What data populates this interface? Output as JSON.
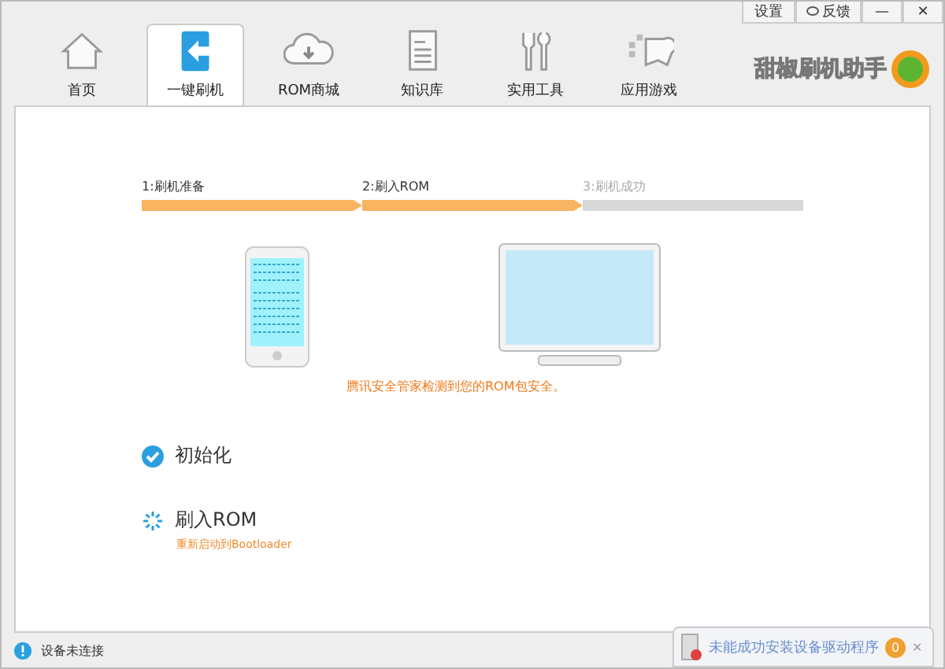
{
  "top_buttons": [
    {
      "kind": "text",
      "label": "设置"
    },
    {
      "kind": "feedback",
      "label": "反馈"
    },
    {
      "kind": "minimize",
      "label": "—"
    },
    {
      "kind": "close",
      "label": "✕"
    }
  ],
  "tabs": [
    {
      "label": "首页",
      "kind": "home",
      "selected": false
    },
    {
      "label": "一键刷机",
      "kind": "flash",
      "selected": true
    },
    {
      "label": "ROM商城",
      "kind": "cloud",
      "selected": false
    },
    {
      "label": "知识库",
      "kind": "doc",
      "selected": false
    },
    {
      "label": "实用工具",
      "kind": "tools",
      "selected": false
    },
    {
      "label": "应用游戏",
      "kind": "game",
      "selected": false
    }
  ],
  "brand": {
    "name": "甜椒刷机助手"
  },
  "steps": [
    {
      "label": "1:刷机准备",
      "reached": true
    },
    {
      "label": "2:刷入ROM",
      "reached": true
    },
    {
      "label": "3:刷机成功",
      "reached": false
    }
  ],
  "security_note": "腾讯安全管家检测到您的ROM包安全。",
  "tasks": [
    {
      "kind": "done",
      "label": "初始化"
    },
    {
      "kind": "loading",
      "label": "刷入ROM",
      "note": "重新启动到Bootloader"
    }
  ],
  "status_bar": {
    "text": "设备未连接"
  },
  "notification": {
    "title": "未能成功安装设备驱动程序",
    "badge": "0",
    "close": "✕"
  }
}
